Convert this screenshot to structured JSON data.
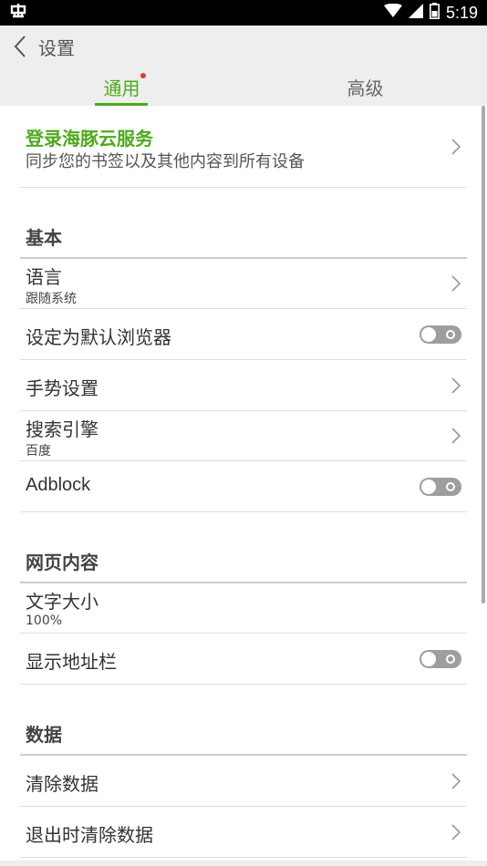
{
  "statusbar": {
    "left_icon": "bug-icon",
    "time": "5:19"
  },
  "header": {
    "title": "设置"
  },
  "tabs": [
    {
      "label": "通用",
      "active": true,
      "badge": "red-dot"
    },
    {
      "label": "高级",
      "active": false
    }
  ],
  "login": {
    "title": "登录海豚云服务",
    "subtitle": "同步您的书签以及其他内容到所有设备"
  },
  "sections": {
    "basic": "基本",
    "web": "网页内容",
    "data": "数据"
  },
  "rows": {
    "language": {
      "label": "语言",
      "value": "跟随系统"
    },
    "default_browser": {
      "label": "设定为默认浏览器",
      "enabled": false
    },
    "gesture": {
      "label": "手势设置"
    },
    "search_engine": {
      "label": "搜索引擎",
      "value": "百度"
    },
    "adblock": {
      "label": "Adblock",
      "enabled": false
    },
    "text_size": {
      "label": "文字大小",
      "value": "100%"
    },
    "show_address_bar": {
      "label": "显示地址栏",
      "enabled": false
    },
    "clear_data": {
      "label": "清除数据"
    },
    "clear_on_exit": {
      "label": "退出时清除数据"
    }
  },
  "colors": {
    "accent": "#4caa1c",
    "badge": "#e53935",
    "toggle_off": "#9e9e9e"
  }
}
